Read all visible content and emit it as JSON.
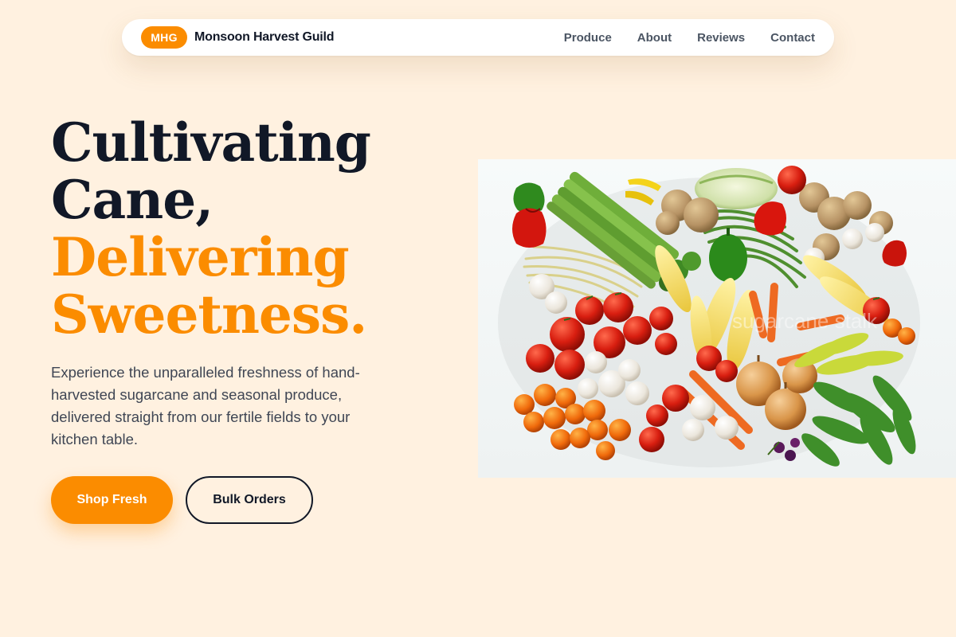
{
  "header": {
    "logo_badge": "MHG",
    "brand_name": "Monsoon Harvest Guild",
    "nav": [
      {
        "label": "Produce"
      },
      {
        "label": "About"
      },
      {
        "label": "Reviews"
      },
      {
        "label": "Contact"
      }
    ]
  },
  "hero": {
    "title_line1": "Cultivating",
    "title_line2": "Cane,",
    "title_line3": "Delivering",
    "title_line4": "Sweetness.",
    "description": "Experience the unparalleled freshness of hand-harvested sugarcane and seasonal produce, delivered straight from our fertile fields to your kitchen table.",
    "primary_button": "Shop Fresh",
    "secondary_button": "Bulk Orders",
    "image_watermark": "sugarcane stalk"
  },
  "colors": {
    "accent": "#fb8c00",
    "background": "#fff1e0",
    "heading": "#111827",
    "body_text": "#3f4654"
  }
}
